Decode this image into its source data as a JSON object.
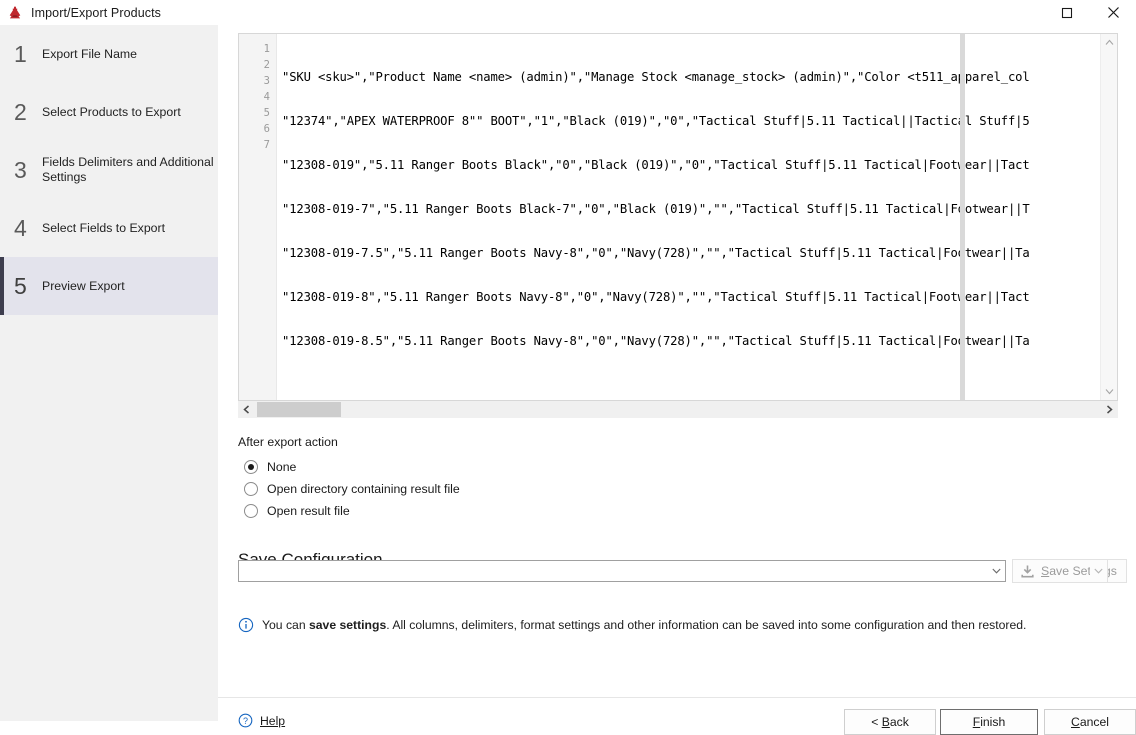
{
  "window": {
    "title": "Import/Export Products",
    "icon": "app-icon",
    "controls": [
      {
        "name": "maximize",
        "glyph": "maximize-icon"
      },
      {
        "name": "close",
        "glyph": "close-icon"
      }
    ]
  },
  "sidebar": {
    "items": [
      {
        "number": "1",
        "label": "Export File Name",
        "active": false
      },
      {
        "number": "2",
        "label": "Select Products to Export",
        "active": false
      },
      {
        "number": "3",
        "label": "Fields Delimiters and Additional Settings",
        "active": false
      },
      {
        "number": "4",
        "label": "Select Fields to Export",
        "active": false
      },
      {
        "number": "5",
        "label": "Preview Export",
        "active": true
      }
    ],
    "active_accent": "#3d3d4e",
    "active_background": "#e3e3ec",
    "background": "#f1f1f1"
  },
  "preview": {
    "line_numbers": [
      "1",
      "2",
      "3",
      "4",
      "5",
      "6",
      "7"
    ],
    "lines": [
      "\"SKU <sku>\",\"Product Name <name> (admin)\",\"Manage Stock <manage_stock> (admin)\",\"Color <t511_apparel_col",
      "\"12374\",\"APEX WATERPROOF 8\"\" BOOT\",\"1\",\"Black (019)\",\"0\",\"Tactical Stuff|5.11 Tactical||Tactical Stuff|5",
      "\"12308-019\",\"5.11 Ranger Boots Black\",\"0\",\"Black (019)\",\"0\",\"Tactical Stuff|5.11 Tactical|Footwear||Tact",
      "\"12308-019-7\",\"5.11 Ranger Boots Black-7\",\"0\",\"Black (019)\",\"\",\"Tactical Stuff|5.11 Tactical|Footwear||T",
      "\"12308-019-7.5\",\"5.11 Ranger Boots Navy-8\",\"0\",\"Navy(728)\",\"\",\"Tactical Stuff|5.11 Tactical|Footwear||Ta",
      "\"12308-019-8\",\"5.11 Ranger Boots Navy-8\",\"0\",\"Navy(728)\",\"\",\"Tactical Stuff|5.11 Tactical|Footwear||Tact",
      "\"12308-019-8.5\",\"5.11 Ranger Boots Navy-8\",\"0\",\"Navy(728)\",\"\",\"Tactical Stuff|5.11 Tactical|Footwear||Ta"
    ]
  },
  "after_export": {
    "title": "After export action",
    "options": [
      {
        "label": "None",
        "checked": true
      },
      {
        "label": "Open directory containing result file",
        "checked": false
      },
      {
        "label": "Open result file",
        "checked": false
      }
    ]
  },
  "save_configuration": {
    "title": "Save Configuration",
    "combo_value": "",
    "combo_placeholder": "",
    "save_button": {
      "label_prefix": "",
      "accelerator": "S",
      "label_suffix": "ave Settings",
      "icon": "save-icon",
      "enabled": false
    }
  },
  "info": {
    "icon": "info-icon",
    "text_prefix": "You can ",
    "text_bold": "save settings",
    "text_suffix": ". All columns, delimiters, format settings and other information can be saved into some configuration and then restored."
  },
  "footer": {
    "help": {
      "label": "Help",
      "icon": "help-icon"
    },
    "back": {
      "prefix": "< ",
      "accelerator": "B",
      "suffix": "ack"
    },
    "finish": {
      "prefix": "",
      "accelerator": "F",
      "suffix": "inish",
      "focused": true
    },
    "cancel": {
      "prefix": "",
      "accelerator": "C",
      "suffix": "ancel"
    }
  }
}
